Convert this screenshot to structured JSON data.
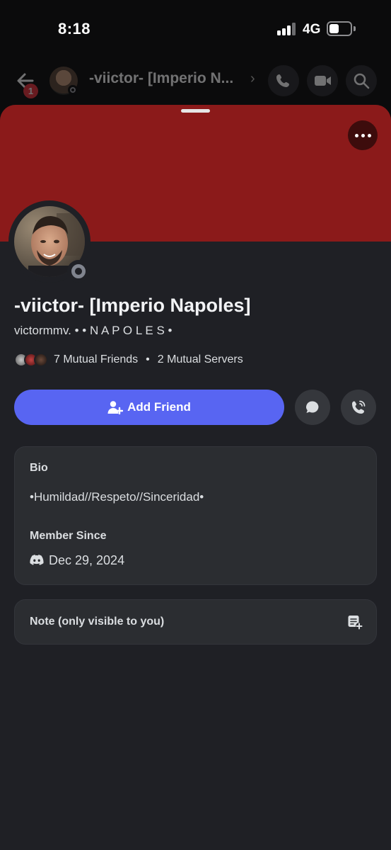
{
  "status_bar": {
    "time": "8:18",
    "network": "4G"
  },
  "chat_header": {
    "title": "-viictor- [Imperio N...",
    "badge_count": "1"
  },
  "profile": {
    "display_name": "-viictor- [Imperio Napoles]",
    "username": "victormmv. • • N A P O L E S •",
    "mutual_friends": "7 Mutual Friends",
    "mutual_servers": "2 Mutual Servers",
    "separator": "•",
    "status": "offline",
    "banner_color": "#8b1a1a"
  },
  "actions": {
    "add_friend_label": "Add Friend",
    "message_icon": "chat-bubble-icon",
    "call_icon": "phone-call-icon"
  },
  "bio_card": {
    "bio_label": "Bio",
    "bio_text": "•Humildad//Respeto//Sinceridad•",
    "member_since_label": "Member Since",
    "member_since_date": "Dec 29, 2024",
    "platform_icon": "discord-icon"
  },
  "note_card": {
    "label": "Note (only visible to you)",
    "icon": "note-add-icon"
  },
  "colors": {
    "accent": "#5865f2",
    "background": "#1f2025",
    "card": "#2b2d31",
    "badge": "#e8333d"
  }
}
